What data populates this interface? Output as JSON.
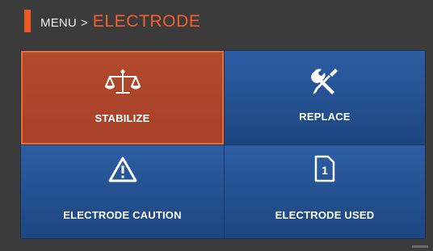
{
  "header": {
    "parent": "MENU",
    "separator": ">",
    "current": "ELECTRODE"
  },
  "tiles": [
    {
      "label": "STABILIZE",
      "icon": "balance-scale-icon",
      "selected": true
    },
    {
      "label": "REPLACE",
      "icon": "tools-icon",
      "selected": false
    },
    {
      "label": "ELECTRODE CAUTION",
      "icon": "warning-icon",
      "selected": false
    },
    {
      "label": "ELECTRODE USED",
      "icon": "document-count-icon",
      "badge": "1",
      "selected": false
    }
  ],
  "colors": {
    "accent": "#ee5a24",
    "tile_blue": "#23508f",
    "tile_selected": "#a8402a"
  }
}
